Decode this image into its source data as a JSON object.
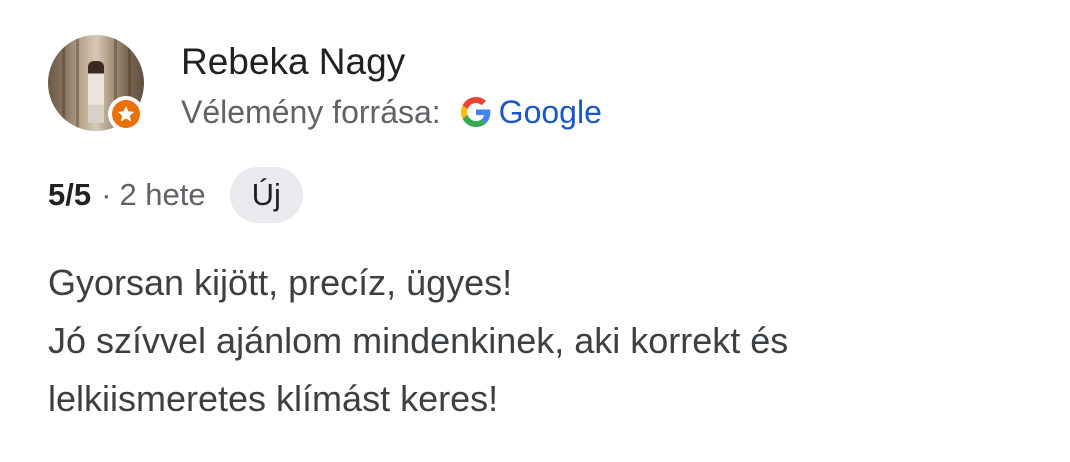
{
  "review": {
    "author": "Rebeka Nagy",
    "source_label": "Vélemény forrása:",
    "source_name": "Google",
    "rating": "5/5",
    "separator": "·",
    "time_ago": "2 hete",
    "new_badge": "Új",
    "text_lines": [
      "Gyorsan kijött, precíz, ügyes!",
      "Jó szívvel ajánlom mindenkinek, aki korrekt és",
      "lelkiismeretes klímást keres!"
    ]
  },
  "icons": {
    "avatar": "user-photo",
    "badge": "local-guide-star-icon",
    "source_logo": "google-g-icon"
  },
  "colors": {
    "link": "#1a57c9",
    "badge": "#e8710a",
    "chip_bg": "#e8eaed"
  }
}
